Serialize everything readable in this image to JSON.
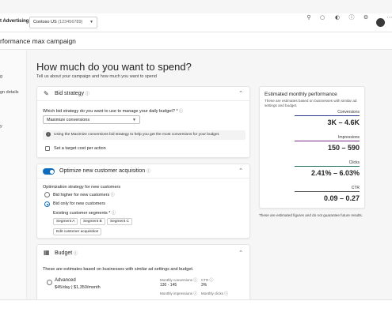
{
  "topbar": {
    "brand": "t Advertising",
    "account_name": "Contoso US",
    "account_id": "(123456789)",
    "icons": [
      "search-icon",
      "bell-icon",
      "copilot-icon",
      "help-icon",
      "gear-icon",
      "avatar"
    ]
  },
  "page": {
    "title": "rformance max campaign"
  },
  "leftnav": {
    "items": [
      "g",
      "gn details",
      "y"
    ]
  },
  "main": {
    "heading": "How much do you want to spend?",
    "subtitle": "Tell us about your campaign and how much you want to spend"
  },
  "bid_strategy": {
    "title": "Bid strategy",
    "question": "Which bid strategy do you want to use to manage your daily budget? *",
    "selected": "Maximize conversions",
    "notice": "Using the Maximize conversions bid strategy to help you get the most conversions for your budget.",
    "target_cost_label": "Set a target cost per action"
  },
  "new_customer": {
    "title": "Optimize new customer acquisition",
    "strategy_label": "Optimization strategy for new customers",
    "option_higher": "Bid higher for new customers",
    "option_only": "Bid only for new customers",
    "segments_label": "Existing customer segments *",
    "segments": [
      "Segment A",
      "Segment B",
      "Segment C"
    ],
    "edit_button": "Edit customer acquisition"
  },
  "budget": {
    "title": "Budget",
    "description": "These are estimates based on businesses with similar ad settings and budget.",
    "option_name": "Advanced",
    "option_price": "$45/day  |  $1,350/month",
    "monthly_conversions_label": "Monthly conversions",
    "monthly_conversions_value": "130 - 145",
    "ctr_label": "CTR",
    "ctr_value": "3%",
    "monthly_impressions_label": "Monthly impressions",
    "monthly_clicks_label": "Monthly clicks"
  },
  "performance": {
    "title": "Estimated monthly performance",
    "description": "These are estimates based on businesses with similar ad settings and budget.",
    "metrics": [
      {
        "label": "Conversions",
        "value": "3K – 4.6K",
        "color": "#2b3a8c"
      },
      {
        "label": "Impressions",
        "value": "150 – 590",
        "color": "#7a2b8c"
      },
      {
        "label": "Clicks",
        "value": "2.41% – 6.03%",
        "color": "#1d6f5f"
      },
      {
        "label": "CTR",
        "value": "0.09 – 0.27",
        "color": "#555555"
      }
    ],
    "footer": "These are estimated figures and do not guarantee future results."
  },
  "colors": {
    "accent": "#0f6cbd",
    "background": "#f6f6f6"
  }
}
